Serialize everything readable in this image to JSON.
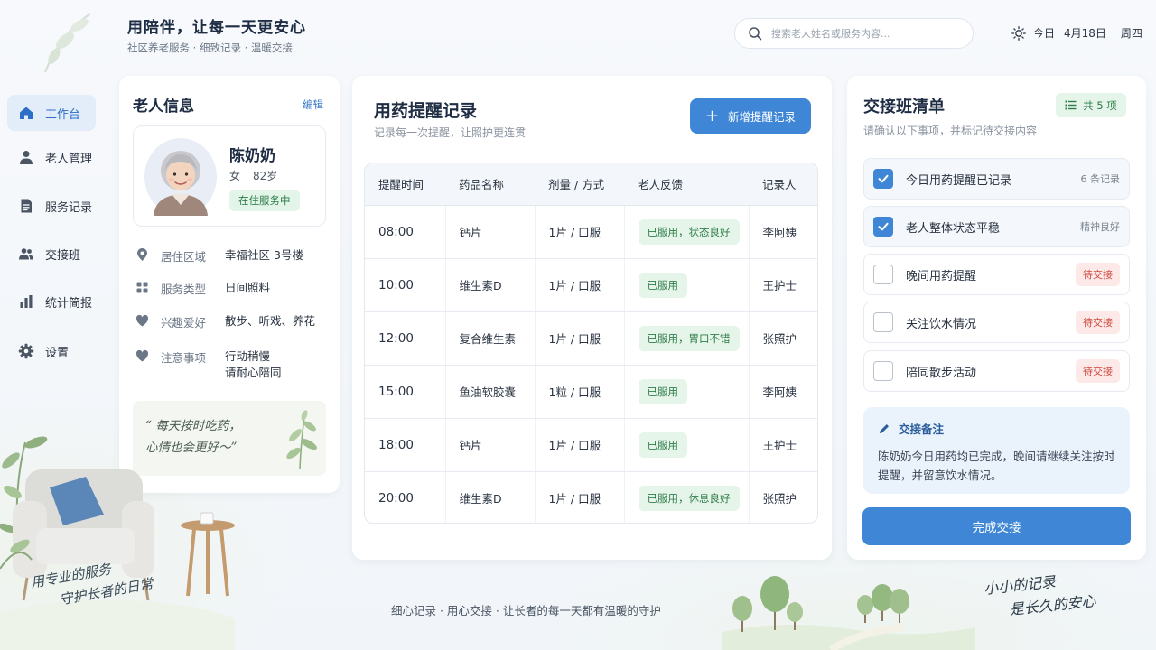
{
  "header": {
    "title": "用陪伴，让每一天更安心",
    "subtitle": "社区养老服务 · 细致记录 · 温暖交接",
    "search_placeholder": "搜索老人姓名或服务内容...",
    "date_today": "今日",
    "date": "4月18日",
    "weekday": "周四"
  },
  "sidebar": {
    "items": [
      {
        "label": "工作台",
        "icon": "home-icon",
        "active": true
      },
      {
        "label": "老人管理",
        "icon": "person-icon"
      },
      {
        "label": "服务记录",
        "icon": "document-icon"
      },
      {
        "label": "交接班",
        "icon": "people-icon"
      },
      {
        "label": "统计简报",
        "icon": "bar-chart-icon"
      },
      {
        "label": "设置",
        "icon": "gear-icon"
      }
    ]
  },
  "elder": {
    "title": "老人信息",
    "edit_label": "编辑",
    "name": "陈奶奶",
    "gender": "女",
    "age": "82岁",
    "status": "在住服务中",
    "info": [
      {
        "label": "居住区域",
        "value": "幸福社区 3号楼",
        "icon": "location-pin-icon"
      },
      {
        "label": "服务类型",
        "value": "日间照料",
        "icon": "grid-icon"
      },
      {
        "label": "兴趣爱好",
        "value": "散步、听戏、养花",
        "icon": "heart-icon"
      },
      {
        "label": "注意事项",
        "value_lines": [
          "行动稍慢",
          "请耐心陪同"
        ],
        "icon": "heart-icon"
      }
    ],
    "quote_lines": [
      "“ 每天按时吃药，",
      "心情也会更好～”"
    ]
  },
  "medication": {
    "title": "用药提醒记录",
    "subtitle": "记录每一次提醒，让照护更连贯",
    "add_button": "新增提醒记录",
    "columns": [
      "提醒时间",
      "药品名称",
      "剂量 / 方式",
      "老人反馈",
      "记录人"
    ],
    "rows": [
      {
        "time": "08:00",
        "drug": "钙片",
        "dose": "1片 / 口服",
        "feedback": "已服用，状态良好",
        "recorder": "李阿姨"
      },
      {
        "time": "10:00",
        "drug": "维生素D",
        "dose": "1片 / 口服",
        "feedback": "已服用",
        "recorder": "王护士"
      },
      {
        "time": "12:00",
        "drug": "复合维生素",
        "dose": "1片 / 口服",
        "feedback": "已服用，胃口不错",
        "recorder": "张照护"
      },
      {
        "time": "15:00",
        "drug": "鱼油软胶囊",
        "dose": "1粒 / 口服",
        "feedback": "已服用",
        "recorder": "李阿姨"
      },
      {
        "time": "18:00",
        "drug": "钙片",
        "dose": "1片 / 口服",
        "feedback": "已服用",
        "recorder": "王护士"
      },
      {
        "time": "20:00",
        "drug": "维生素D",
        "dose": "1片 / 口服",
        "feedback": "已服用，休息良好",
        "recorder": "张照护"
      }
    ]
  },
  "handover": {
    "title": "交接班清单",
    "subtitle": "请确认以下事项，并标记待交接内容",
    "count_label": "共 5 项",
    "items": [
      {
        "label": "今日用药提醒已记录",
        "checked": true,
        "status": "6 条记录"
      },
      {
        "label": "老人整体状态平稳",
        "checked": true,
        "status": "精神良好"
      },
      {
        "label": "晚间用药提醒",
        "checked": false,
        "status": "待交接"
      },
      {
        "label": "关注饮水情况",
        "checked": false,
        "status": "待交接"
      },
      {
        "label": "陪同散步活动",
        "checked": false,
        "status": "待交接"
      }
    ],
    "note_title": "交接备注",
    "note_text": "陈奶奶今日用药均已完成，晚间请继续关注按时提醒，并留意饮水情况。",
    "complete_button": "完成交接"
  },
  "footer": {
    "text": "细心记录 · 用心交接 · 让长者的每一天都有温暖的守护",
    "slogan_left": [
      "用专业的服务",
      "守护长者的日常"
    ],
    "slogan_right": [
      "小小的记录",
      "是长久的安心"
    ]
  },
  "colors": {
    "accent": "#3f87d6",
    "success_bg": "#e6f5ea",
    "success_text": "#2f7d4b",
    "pending_bg": "#fde9e7",
    "pending_text": "#d04a43"
  }
}
